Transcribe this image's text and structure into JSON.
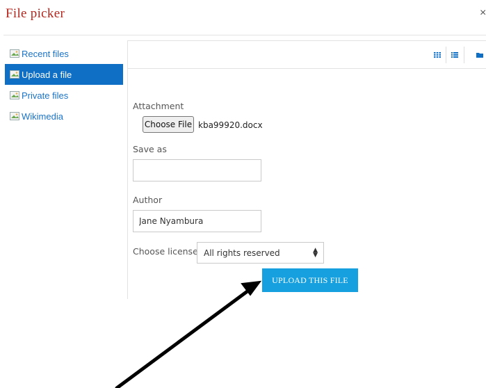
{
  "dialog": {
    "title": "File picker",
    "close_glyph": "×"
  },
  "sidebar": {
    "items": [
      {
        "label": "Recent files",
        "active": false
      },
      {
        "label": "Upload a file",
        "active": true
      },
      {
        "label": "Private files",
        "active": false
      },
      {
        "label": "Wikimedia",
        "active": false
      }
    ]
  },
  "toolbar": {
    "icons": [
      "icon-view-grid-icon",
      "list-view-icon",
      "folder-view-icon"
    ]
  },
  "form": {
    "attachment_label": "Attachment",
    "choose_file_label": "Choose File",
    "selected_file": "kba99920.docx",
    "save_as_label": "Save as",
    "save_as_value": "",
    "author_label": "Author",
    "author_value": "Jane Nyambura",
    "license_label": "Choose license",
    "license_value": "All rights reserved",
    "upload_button": "UPLOAD THIS FILE"
  },
  "colors": {
    "title": "#b3261e",
    "active_sidebar": "#0f6fc5",
    "link": "#1a73c9",
    "upload_button": "#16a0df",
    "toolbar_icons": "#0f6fc5"
  }
}
